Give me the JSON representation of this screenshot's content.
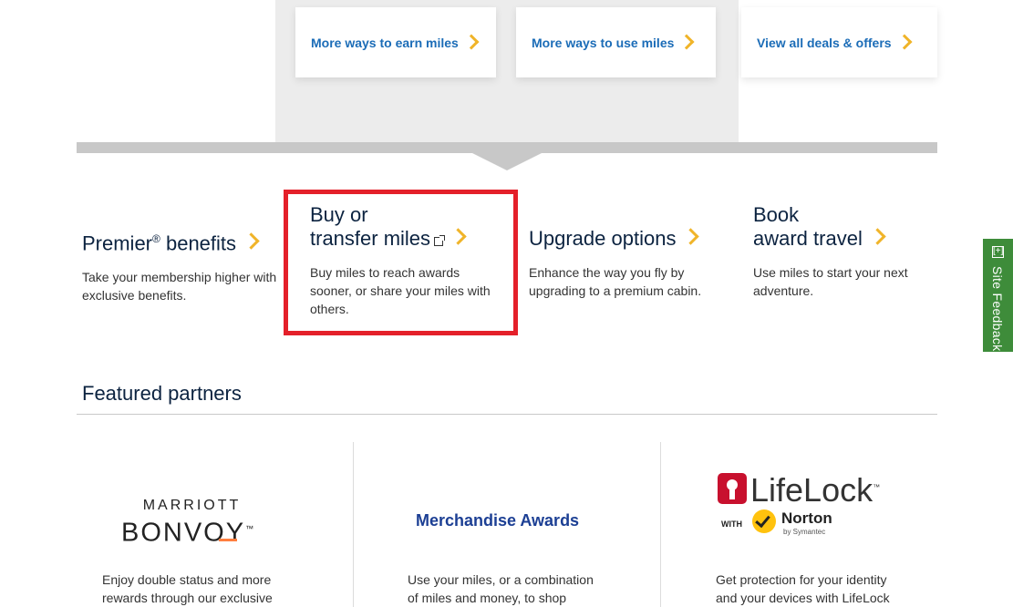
{
  "top_links": [
    {
      "label": "More ways to earn miles"
    },
    {
      "label": "More ways to use miles"
    },
    {
      "label": "View all deals & offers"
    }
  ],
  "benefits": [
    {
      "title": "Premier",
      "title_sup": "®",
      "title_rest": " benefits",
      "desc": "Take your membership higher with exclusive benefits."
    },
    {
      "title_line1": "Buy or",
      "title_line2": "transfer miles",
      "desc": "Buy miles to reach awards sooner, or share your miles with others."
    },
    {
      "title": "Upgrade options",
      "desc": "Enhance the way you fly by upgrading to a premium cabin."
    },
    {
      "title_line1": "Book",
      "title_line2": "award travel",
      "desc": "Use miles to start your next adventure."
    }
  ],
  "featured": {
    "title": "Featured partners",
    "partners": [
      {
        "logo_line1": "MARRIOTT",
        "logo_line2": "BONVOY",
        "logo_tm": "™",
        "desc_line1": "Enjoy double status and more",
        "desc_line2": "rewards through our exclusive"
      },
      {
        "logo": "Merchandise Awards",
        "desc_line1": "Use your miles, or a combination",
        "desc_line2": "of miles and money, to shop"
      },
      {
        "logo_main": "LifeLock",
        "logo_tm": "™",
        "logo_with": "WITH",
        "logo_norton": "Norton",
        "logo_sub": "by Symantec",
        "desc_line1": "Get protection for your identity",
        "desc_line2": "and your devices with LifeLock"
      }
    ]
  },
  "feedback": {
    "label": "Site Feedback",
    "icon": "[+]"
  },
  "colors": {
    "link": "#1b6cb7",
    "chevron": "#f0b429",
    "title": "#0c2340",
    "highlight": "#e4202a",
    "feedback": "#3e8c3a"
  }
}
